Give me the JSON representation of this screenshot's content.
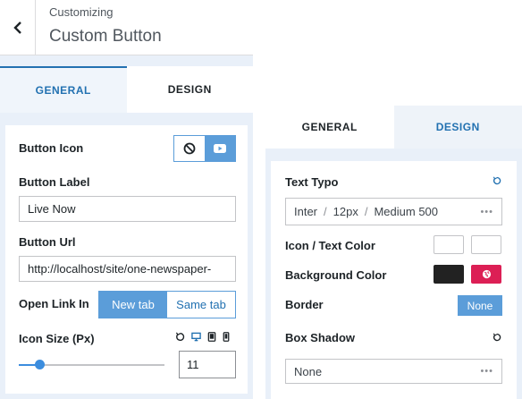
{
  "header": {
    "subtitle": "Customizing",
    "title": "Custom Button"
  },
  "left_tabs": [
    "GENERAL",
    "DESIGN"
  ],
  "general": {
    "button_icon_label": "Button Icon",
    "button_label_label": "Button Label",
    "button_label_value": "Live Now",
    "button_url_label": "Button Url",
    "button_url_value": "http://localhost/site/one-newspaper-",
    "open_link_label": "Open Link In",
    "open_link_options": [
      "New tab",
      "Same tab"
    ],
    "open_link_selected": "New tab",
    "icon_size_label": "Icon Size (Px)",
    "icon_size_value": "11",
    "icon_size_slider_fraction": 0.14
  },
  "right_tabs": [
    "GENERAL",
    "DESIGN"
  ],
  "design": {
    "text_typo_label": "Text Typo",
    "typo_font": "Inter",
    "typo_size": "12px",
    "typo_weight": "Medium 500",
    "icon_text_color_label": "Icon / Text Color",
    "background_color_label": "Background Color",
    "border_label": "Border",
    "border_value": "None",
    "box_shadow_label": "Box Shadow",
    "box_shadow_value": "None"
  },
  "colors": {
    "accent": "#5b9dd9",
    "link_blue": "#2271b1",
    "bg_swatch_1": "#222222",
    "bg_swatch_2": "#dc1f55",
    "panel_bg": "#e9f0f9"
  }
}
